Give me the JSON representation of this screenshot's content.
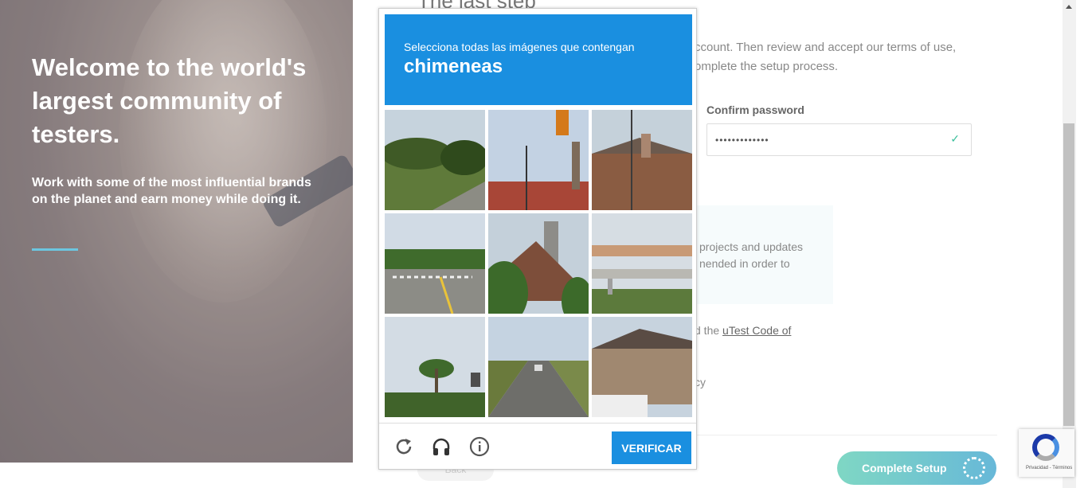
{
  "hero": {
    "title": "Welcome to the world's largest community of testers.",
    "subtitle": "Work with some of the most influential brands on the planet and earn money while doing it."
  },
  "form": {
    "title": "The last step",
    "description": "ccount. Then review and accept our terms of use, omplete the setup process.",
    "confirm_password_label": "Confirm password",
    "confirm_password_value": "•••••••••••••",
    "info_line1": "projects and updates",
    "info_line2": "nended in order to",
    "code_prefix": "d the ",
    "code_link": "uTest Code of",
    "privacy_fragment": "cy",
    "back_label": "Back",
    "complete_button": "Complete Setup"
  },
  "captcha": {
    "instruction": "Selecciona todas las imágenes que contengan",
    "target": "chimeneas",
    "verify_button": "VERIFICAR",
    "icons": [
      "reload-icon",
      "audio-icon",
      "info-icon"
    ]
  },
  "recaptcha_badge": {
    "terms": "Privacidad - Términos"
  },
  "colors": {
    "captcha_blue": "#1a8fe0",
    "accent_teal": "#6cc6e0",
    "button_gradient_start": "#7fd7c4",
    "button_gradient_end": "#67b8d8"
  }
}
